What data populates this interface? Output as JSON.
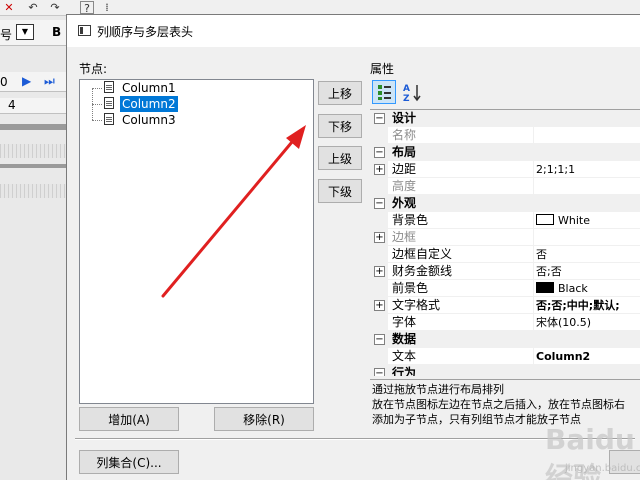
{
  "background_app": {
    "toolbar_icons": [
      "close-x-icon",
      "undo-icon",
      "redo-icon",
      "help-icon",
      "align-icon"
    ],
    "font_size_label": "号",
    "bold_label": "B",
    "zoom_value": "0",
    "ruler_value": "4"
  },
  "dialog": {
    "title": "列顺序与多层表头",
    "nodes_label": "节点:",
    "properties_label": "属性",
    "tree": [
      {
        "label": "Column1",
        "selected": false
      },
      {
        "label": "Column2",
        "selected": true
      },
      {
        "label": "Column3",
        "selected": false
      }
    ],
    "buttons": {
      "move_up": "上移",
      "move_down": "下移",
      "level_up": "上级",
      "level_down": "下级",
      "add": "增加(A)",
      "remove": "移除(R)",
      "column_set": "列集合(C)..."
    },
    "property_grid": {
      "rows": [
        {
          "type": "category",
          "label": "设计"
        },
        {
          "type": "prop",
          "name": "名称",
          "value": "",
          "disabled": true
        },
        {
          "type": "category",
          "label": "布局"
        },
        {
          "type": "prop",
          "name": "边距",
          "value": "2;1;1;1",
          "expandable": true
        },
        {
          "type": "prop",
          "name": "高度",
          "value": "",
          "disabled": true
        },
        {
          "type": "category",
          "label": "外观"
        },
        {
          "type": "prop",
          "name": "背景色",
          "value": "White",
          "swatch": "#ffffff"
        },
        {
          "type": "prop",
          "name": "边框",
          "value": "",
          "disabled": true,
          "expandable": true
        },
        {
          "type": "prop",
          "name": "边框自定义",
          "value": "否"
        },
        {
          "type": "prop",
          "name": "财务金额线",
          "value": "否;否",
          "expandable": true
        },
        {
          "type": "prop",
          "name": "前景色",
          "value": "Black",
          "swatch": "#000000"
        },
        {
          "type": "prop",
          "name": "文字格式",
          "value": "否;否;中中;默认;",
          "expandable": true,
          "bold": true
        },
        {
          "type": "prop",
          "name": "字体",
          "value": "宋体(10.5)"
        },
        {
          "type": "category",
          "label": "数据"
        },
        {
          "type": "prop",
          "name": "文本",
          "value": "Column2",
          "bold": true
        },
        {
          "type": "category",
          "label": "行为"
        }
      ]
    },
    "description": [
      "通过拖放节点进行布局排列",
      "放在节点图标左边在节点之后插入，放在节点图标右",
      "添加为子节点，只有列组节点才能放子节点"
    ],
    "watermark": "Baidu经验",
    "watermark_sub": "jingyan.baidu.com"
  },
  "colors": {
    "selection": "#0078d7",
    "arrow": "#e02020",
    "window_bg": "#f0f0f0"
  }
}
